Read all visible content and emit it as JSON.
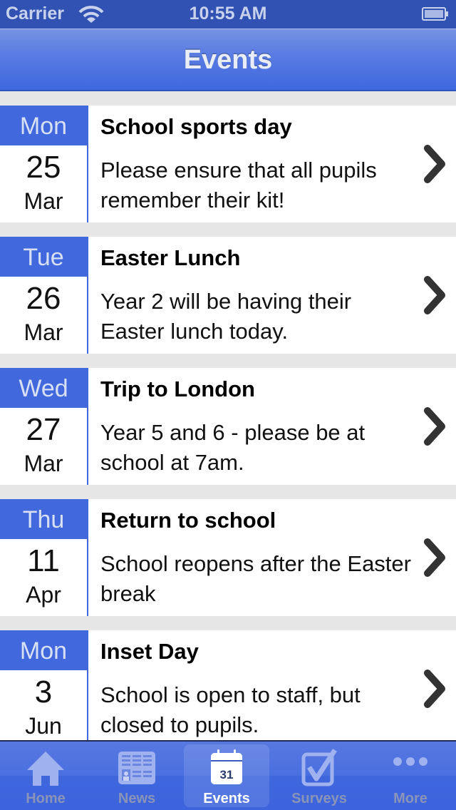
{
  "status_bar": {
    "carrier": "Carrier",
    "time": "10:55 AM"
  },
  "nav": {
    "title": "Events"
  },
  "events": [
    {
      "dow": "Mon",
      "day": "25",
      "month": "Mar",
      "title": "School sports day",
      "description": "Please ensure that all pupils remember their kit!"
    },
    {
      "dow": "Tue",
      "day": "26",
      "month": "Mar",
      "title": "Easter Lunch",
      "description": "Year 2 will be having their Easter lunch today."
    },
    {
      "dow": "Wed",
      "day": "27",
      "month": "Mar",
      "title": "Trip to London",
      "description": "Year 5 and 6 - please be at school at 7am."
    },
    {
      "dow": "Thu",
      "day": "11",
      "month": "Apr",
      "title": "Return to school",
      "description": "School reopens after the Easter break"
    },
    {
      "dow": "Mon",
      "day": "3",
      "month": "Jun",
      "title": "Inset Day",
      "description": "School is open to staff, but closed to pupils."
    }
  ],
  "tabs": [
    {
      "label": "Home",
      "icon": "home-icon"
    },
    {
      "label": "News",
      "icon": "news-icon"
    },
    {
      "label": "Events",
      "icon": "calendar-icon",
      "badge": "31",
      "active": true
    },
    {
      "label": "Surveys",
      "icon": "checkbox-icon"
    },
    {
      "label": "More",
      "icon": "more-icon"
    }
  ],
  "colors": {
    "accent": "#4168dc",
    "status_bar": "#3152b3",
    "background": "#e6e6e6"
  }
}
